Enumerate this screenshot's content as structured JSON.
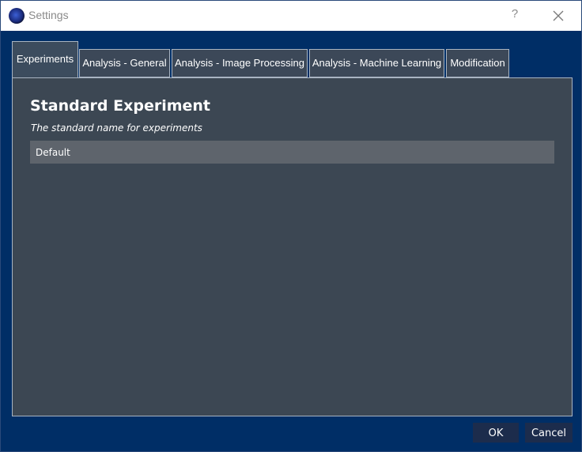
{
  "window": {
    "title": "Settings",
    "help_label": "?"
  },
  "tabs": [
    {
      "label": "Experiments",
      "active": true
    },
    {
      "label": "Analysis - General",
      "active": false
    },
    {
      "label": "Analysis - Image Processing",
      "active": false
    },
    {
      "label": "Analysis - Machine Learning",
      "active": false
    },
    {
      "label": "Modification",
      "active": false
    }
  ],
  "panel": {
    "setting_title": "Standard Experiment",
    "setting_description": "The standard name for experiments",
    "setting_value": "Default"
  },
  "buttons": {
    "ok_label": "OK",
    "cancel_label": "Cancel"
  },
  "colors": {
    "window_background": "#002e66",
    "panel_background": "#3c4753",
    "input_background": "#5e646c",
    "button_background": "#1c2c4c"
  }
}
